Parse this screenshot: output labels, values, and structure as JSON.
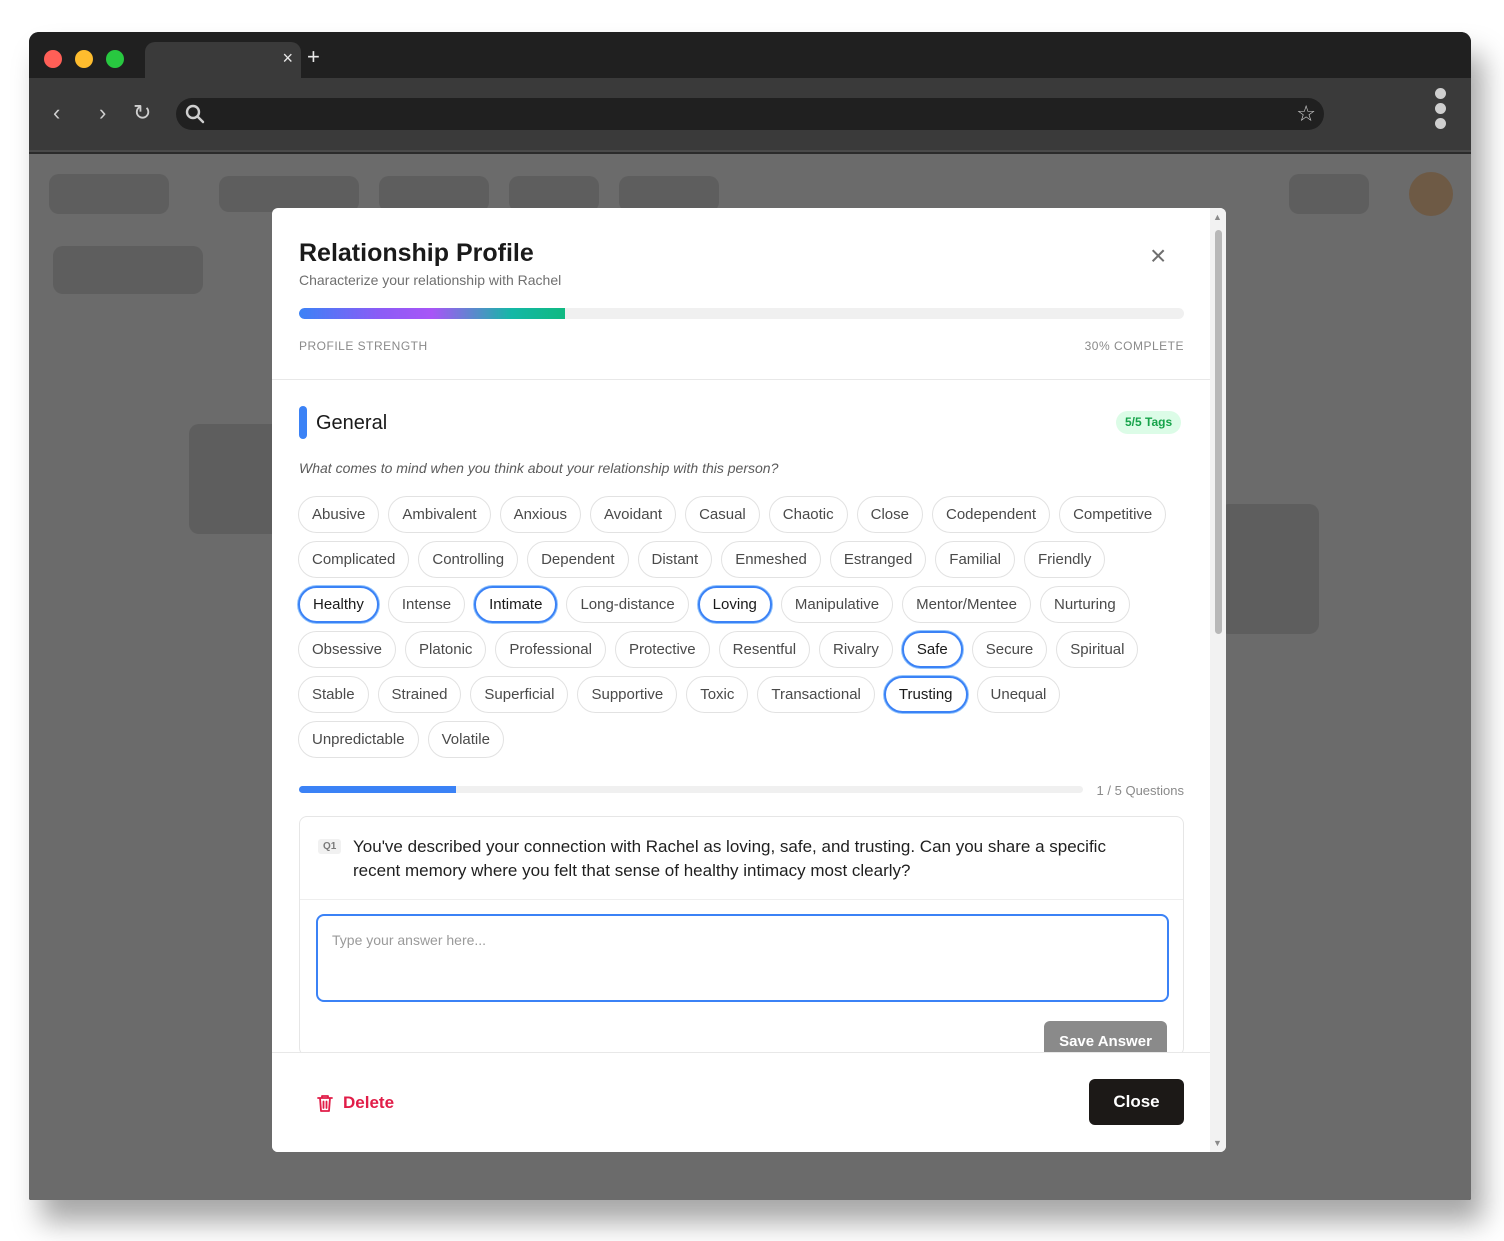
{
  "browser": {
    "tab_title": "",
    "tab_close": "×",
    "new_tab": "+",
    "address": "",
    "back": "‹",
    "forward": "›",
    "reload": "↻",
    "star": "☆"
  },
  "modal": {
    "title": "Relationship Profile",
    "subtitle": "Characterize your relationship with Rachel",
    "close_icon": "×",
    "profile_strength_label": "PROFILE STRENGTH",
    "profile_strength_value": "30% COMPLETE",
    "profile_strength_fraction": 0.3
  },
  "section": {
    "title": "General",
    "tag_count": "5/5 Tags",
    "prompt": "What comes to mind when you think about your relationship with this person?",
    "accent_color": "#3b82f6",
    "tag_rows": [
      [
        {
          "label": "Abusive",
          "selected": false
        },
        {
          "label": "Ambivalent",
          "selected": false
        },
        {
          "label": "Anxious",
          "selected": false
        },
        {
          "label": "Avoidant",
          "selected": false
        },
        {
          "label": "Casual",
          "selected": false
        },
        {
          "label": "Chaotic",
          "selected": false
        },
        {
          "label": "Close",
          "selected": false
        },
        {
          "label": "Codependent",
          "selected": false
        },
        {
          "label": "Competitive",
          "selected": false
        }
      ],
      [
        {
          "label": "Complicated",
          "selected": false
        },
        {
          "label": "Controlling",
          "selected": false
        },
        {
          "label": "Dependent",
          "selected": false
        },
        {
          "label": "Distant",
          "selected": false
        },
        {
          "label": "Enmeshed",
          "selected": false
        },
        {
          "label": "Estranged",
          "selected": false
        },
        {
          "label": "Familial",
          "selected": false
        },
        {
          "label": "Friendly",
          "selected": false
        }
      ],
      [
        {
          "label": "Healthy",
          "selected": true
        },
        {
          "label": "Intense",
          "selected": false
        },
        {
          "label": "Intimate",
          "selected": true
        },
        {
          "label": "Long-distance",
          "selected": false
        },
        {
          "label": "Loving",
          "selected": true
        },
        {
          "label": "Manipulative",
          "selected": false
        },
        {
          "label": "Mentor/Mentee",
          "selected": false
        },
        {
          "label": "Nurturing",
          "selected": false
        }
      ],
      [
        {
          "label": "Obsessive",
          "selected": false
        },
        {
          "label": "Platonic",
          "selected": false
        },
        {
          "label": "Professional",
          "selected": false
        },
        {
          "label": "Protective",
          "selected": false
        },
        {
          "label": "Resentful",
          "selected": false
        },
        {
          "label": "Rivalry",
          "selected": false
        },
        {
          "label": "Safe",
          "selected": true
        },
        {
          "label": "Secure",
          "selected": false
        },
        {
          "label": "Spiritual",
          "selected": false
        }
      ],
      [
        {
          "label": "Stable",
          "selected": false
        },
        {
          "label": "Strained",
          "selected": false
        },
        {
          "label": "Superficial",
          "selected": false
        },
        {
          "label": "Supportive",
          "selected": false
        },
        {
          "label": "Toxic",
          "selected": false
        },
        {
          "label": "Transactional",
          "selected": false
        },
        {
          "label": "Trusting",
          "selected": true
        },
        {
          "label": "Unequal",
          "selected": false
        }
      ],
      [
        {
          "label": "Unpredictable",
          "selected": false
        },
        {
          "label": "Volatile",
          "selected": false
        }
      ]
    ]
  },
  "questions": {
    "progress_label": "1 / 5 Questions",
    "progress_fraction": 0.2,
    "current": {
      "badge": "Q1",
      "text": "You've described your connection with Rachel as loving, safe, and trusting. Can you share a specific recent memory where you felt that sense of healthy intimacy most clearly?",
      "answer_value": "",
      "answer_placeholder": "Type your answer here...",
      "save_label": "Save Answer"
    }
  },
  "footer": {
    "delete_label": "Delete",
    "close_label": "Close",
    "delete_color": "#e11d48"
  }
}
